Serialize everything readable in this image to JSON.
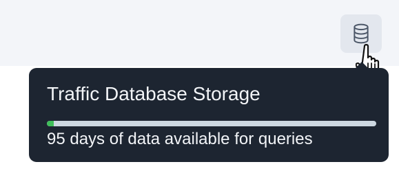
{
  "storage_button": {
    "icon": "database-icon"
  },
  "tooltip": {
    "title": "Traffic Database Storage",
    "usage_fraction": 0.02,
    "description": "95 days of data available for queries"
  },
  "colors": {
    "tooltip_background": "#1d2531",
    "progress_track": "#cdd8e1",
    "progress_fill": "#3fbf5a",
    "button_background": "#e3e7ee"
  }
}
